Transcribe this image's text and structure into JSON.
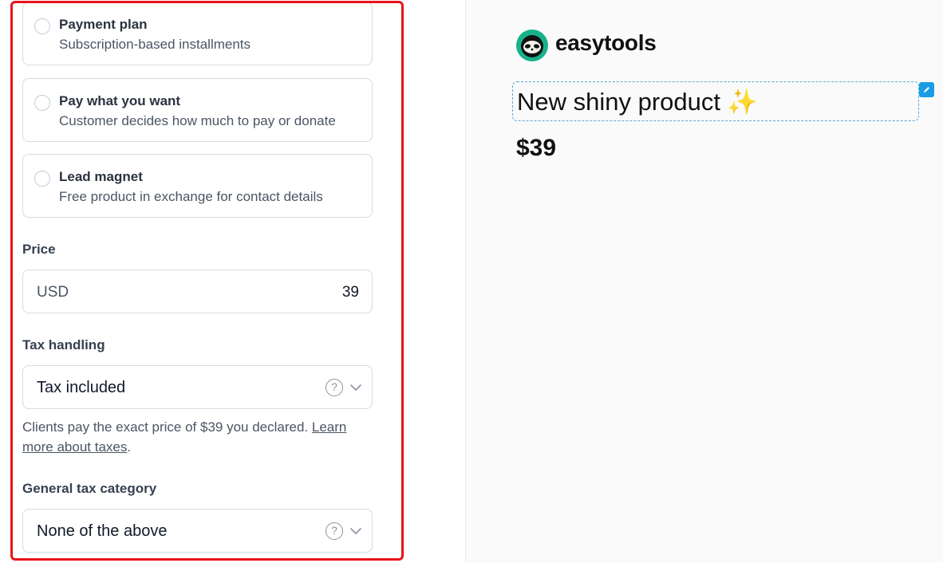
{
  "pricing_options": [
    {
      "title": "Payment plan",
      "description": "Subscription-based installments"
    },
    {
      "title": "Pay what you want",
      "description": "Customer decides how much to pay or donate"
    },
    {
      "title": "Lead magnet",
      "description": "Free product in exchange for contact details"
    }
  ],
  "price": {
    "label": "Price",
    "currency": "USD",
    "value": "39"
  },
  "tax_handling": {
    "label": "Tax handling",
    "selected": "Tax included",
    "hint": "Clients pay the exact price of $39 you declared.",
    "link_text": "Learn more about taxes",
    "link_suffix": "."
  },
  "tax_category": {
    "label": "General tax category",
    "selected": "None of the above"
  },
  "icons": {
    "help": "question-circle-icon",
    "chevron": "chevron-down-icon",
    "edit": "pencil-icon",
    "logo": "sloth-logo-icon"
  },
  "preview": {
    "brand": "easytools",
    "product_title": "New shiny product",
    "sparkle": "✨",
    "product_price": "$39"
  },
  "colors": {
    "highlight": "#e8141a",
    "brand_green": "#18b28a",
    "edit_blue": "#1a9be6"
  }
}
